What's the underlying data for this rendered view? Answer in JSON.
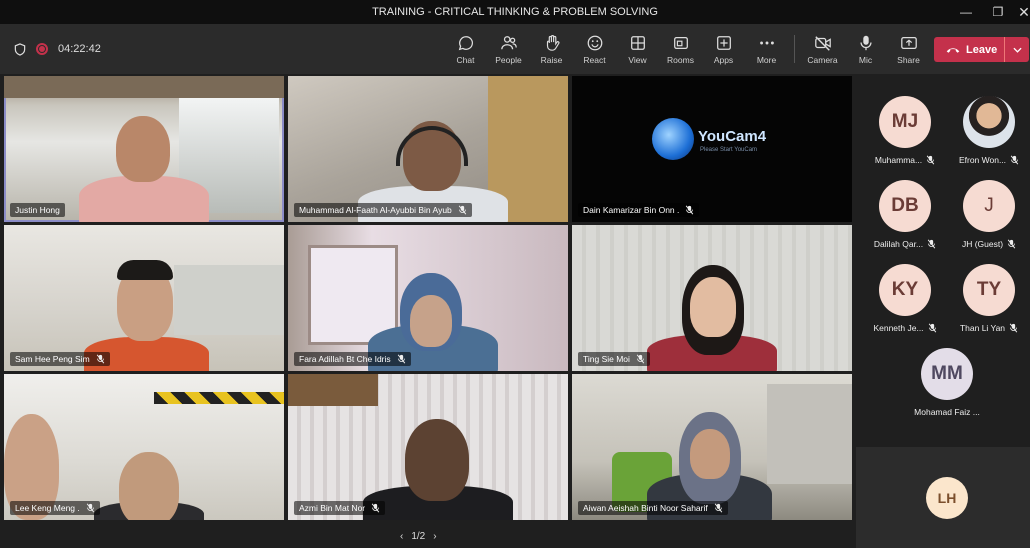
{
  "window": {
    "title": "TRAINING - CRITICAL THINKING & PROBLEM SOLVING"
  },
  "meeting": {
    "timer": "04:22:42"
  },
  "toolbar": [
    {
      "label": "Chat",
      "icon": "chat-icon"
    },
    {
      "label": "People",
      "icon": "people-icon"
    },
    {
      "label": "Raise",
      "icon": "raise-hand-icon"
    },
    {
      "label": "React",
      "icon": "react-icon"
    },
    {
      "label": "View",
      "icon": "view-icon"
    },
    {
      "label": "Rooms",
      "icon": "rooms-icon"
    },
    {
      "label": "Apps",
      "icon": "apps-icon"
    },
    {
      "label": "More",
      "icon": "more-icon"
    },
    {
      "label": "Camera",
      "icon": "camera-off-icon"
    },
    {
      "label": "Mic",
      "icon": "mic-icon"
    },
    {
      "label": "Share",
      "icon": "share-icon"
    }
  ],
  "leave": {
    "label": "Leave"
  },
  "participants_video": [
    {
      "name": "Justin Hong"
    },
    {
      "name": "Muhammad Al-Faath Al-Ayubbi Bin Ayub"
    },
    {
      "name": "Dain Kamarizar Bin Onn ."
    },
    {
      "name": "Sam Hee Peng Sim"
    },
    {
      "name": "Fara Adillah Bt Che Idris"
    },
    {
      "name": "Ting Sie Moi"
    },
    {
      "name": "Lee Keng Meng ."
    },
    {
      "name": "Azmi Bin Mat Nor"
    },
    {
      "name": "Aiwan Aeishah Binti Noor Saharif"
    }
  ],
  "youcam": {
    "brand": "YouCam4",
    "sub": "Please Start YouCam"
  },
  "roster": [
    {
      "initials": "MJ",
      "name": "Muhamma..."
    },
    {
      "initials": "",
      "name": "Efron Won..."
    },
    {
      "initials": "DB",
      "name": "Dalilah Qar..."
    },
    {
      "initials": "J",
      "name": "JH (Guest)"
    },
    {
      "initials": "KY",
      "name": "Kenneth Je..."
    },
    {
      "initials": "TY",
      "name": "Than Li Yan"
    },
    {
      "initials": "MM",
      "name": "Mohamad Faiz ..."
    }
  ],
  "self": {
    "initials": "LH"
  },
  "pager": {
    "label": "1/2"
  },
  "colors": {
    "accent": "#8b8cc7",
    "leave": "#c4314b"
  }
}
